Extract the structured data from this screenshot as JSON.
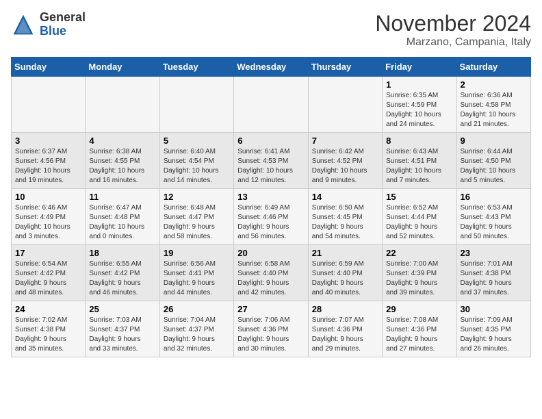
{
  "logo": {
    "text_general": "General",
    "text_blue": "Blue"
  },
  "header": {
    "month": "November 2024",
    "location": "Marzano, Campania, Italy"
  },
  "weekdays": [
    "Sunday",
    "Monday",
    "Tuesday",
    "Wednesday",
    "Thursday",
    "Friday",
    "Saturday"
  ],
  "weeks": [
    [
      {
        "day": "",
        "info": ""
      },
      {
        "day": "",
        "info": ""
      },
      {
        "day": "",
        "info": ""
      },
      {
        "day": "",
        "info": ""
      },
      {
        "day": "",
        "info": ""
      },
      {
        "day": "1",
        "info": "Sunrise: 6:35 AM\nSunset: 4:59 PM\nDaylight: 10 hours\nand 24 minutes."
      },
      {
        "day": "2",
        "info": "Sunrise: 6:36 AM\nSunset: 4:58 PM\nDaylight: 10 hours\nand 21 minutes."
      }
    ],
    [
      {
        "day": "3",
        "info": "Sunrise: 6:37 AM\nSunset: 4:56 PM\nDaylight: 10 hours\nand 19 minutes."
      },
      {
        "day": "4",
        "info": "Sunrise: 6:38 AM\nSunset: 4:55 PM\nDaylight: 10 hours\nand 16 minutes."
      },
      {
        "day": "5",
        "info": "Sunrise: 6:40 AM\nSunset: 4:54 PM\nDaylight: 10 hours\nand 14 minutes."
      },
      {
        "day": "6",
        "info": "Sunrise: 6:41 AM\nSunset: 4:53 PM\nDaylight: 10 hours\nand 12 minutes."
      },
      {
        "day": "7",
        "info": "Sunrise: 6:42 AM\nSunset: 4:52 PM\nDaylight: 10 hours\nand 9 minutes."
      },
      {
        "day": "8",
        "info": "Sunrise: 6:43 AM\nSunset: 4:51 PM\nDaylight: 10 hours\nand 7 minutes."
      },
      {
        "day": "9",
        "info": "Sunrise: 6:44 AM\nSunset: 4:50 PM\nDaylight: 10 hours\nand 5 minutes."
      }
    ],
    [
      {
        "day": "10",
        "info": "Sunrise: 6:46 AM\nSunset: 4:49 PM\nDaylight: 10 hours\nand 3 minutes."
      },
      {
        "day": "11",
        "info": "Sunrise: 6:47 AM\nSunset: 4:48 PM\nDaylight: 10 hours\nand 0 minutes."
      },
      {
        "day": "12",
        "info": "Sunrise: 6:48 AM\nSunset: 4:47 PM\nDaylight: 9 hours\nand 58 minutes."
      },
      {
        "day": "13",
        "info": "Sunrise: 6:49 AM\nSunset: 4:46 PM\nDaylight: 9 hours\nand 56 minutes."
      },
      {
        "day": "14",
        "info": "Sunrise: 6:50 AM\nSunset: 4:45 PM\nDaylight: 9 hours\nand 54 minutes."
      },
      {
        "day": "15",
        "info": "Sunrise: 6:52 AM\nSunset: 4:44 PM\nDaylight: 9 hours\nand 52 minutes."
      },
      {
        "day": "16",
        "info": "Sunrise: 6:53 AM\nSunset: 4:43 PM\nDaylight: 9 hours\nand 50 minutes."
      }
    ],
    [
      {
        "day": "17",
        "info": "Sunrise: 6:54 AM\nSunset: 4:42 PM\nDaylight: 9 hours\nand 48 minutes."
      },
      {
        "day": "18",
        "info": "Sunrise: 6:55 AM\nSunset: 4:42 PM\nDaylight: 9 hours\nand 46 minutes."
      },
      {
        "day": "19",
        "info": "Sunrise: 6:56 AM\nSunset: 4:41 PM\nDaylight: 9 hours\nand 44 minutes."
      },
      {
        "day": "20",
        "info": "Sunrise: 6:58 AM\nSunset: 4:40 PM\nDaylight: 9 hours\nand 42 minutes."
      },
      {
        "day": "21",
        "info": "Sunrise: 6:59 AM\nSunset: 4:40 PM\nDaylight: 9 hours\nand 40 minutes."
      },
      {
        "day": "22",
        "info": "Sunrise: 7:00 AM\nSunset: 4:39 PM\nDaylight: 9 hours\nand 39 minutes."
      },
      {
        "day": "23",
        "info": "Sunrise: 7:01 AM\nSunset: 4:38 PM\nDaylight: 9 hours\nand 37 minutes."
      }
    ],
    [
      {
        "day": "24",
        "info": "Sunrise: 7:02 AM\nSunset: 4:38 PM\nDaylight: 9 hours\nand 35 minutes."
      },
      {
        "day": "25",
        "info": "Sunrise: 7:03 AM\nSunset: 4:37 PM\nDaylight: 9 hours\nand 33 minutes."
      },
      {
        "day": "26",
        "info": "Sunrise: 7:04 AM\nSunset: 4:37 PM\nDaylight: 9 hours\nand 32 minutes."
      },
      {
        "day": "27",
        "info": "Sunrise: 7:06 AM\nSunset: 4:36 PM\nDaylight: 9 hours\nand 30 minutes."
      },
      {
        "day": "28",
        "info": "Sunrise: 7:07 AM\nSunset: 4:36 PM\nDaylight: 9 hours\nand 29 minutes."
      },
      {
        "day": "29",
        "info": "Sunrise: 7:08 AM\nSunset: 4:36 PM\nDaylight: 9 hours\nand 27 minutes."
      },
      {
        "day": "30",
        "info": "Sunrise: 7:09 AM\nSunset: 4:35 PM\nDaylight: 9 hours\nand 26 minutes."
      }
    ]
  ]
}
